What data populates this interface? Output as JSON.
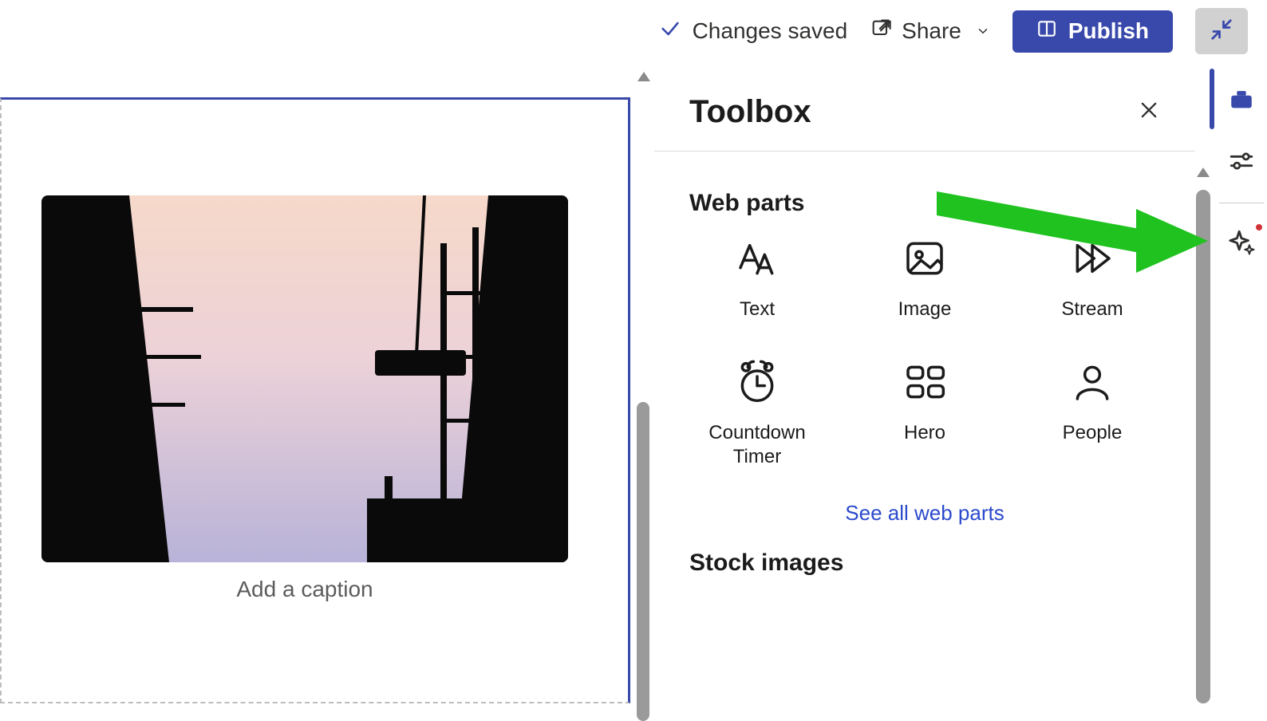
{
  "topbar": {
    "status_label": "Changes saved",
    "share_label": "Share",
    "publish_label": "Publish"
  },
  "canvas": {
    "caption_placeholder": "Add a caption"
  },
  "panel": {
    "title": "Toolbox",
    "sections": {
      "webparts_title": "Web parts",
      "stock_title": "Stock images",
      "see_all_label": "See all web parts"
    },
    "webparts": [
      {
        "name": "Text",
        "icon": "text-icon"
      },
      {
        "name": "Image",
        "icon": "image-icon"
      },
      {
        "name": "Stream",
        "icon": "stream-icon"
      },
      {
        "name": "Countdown Timer",
        "icon": "countdown-icon"
      },
      {
        "name": "Hero",
        "icon": "hero-icon"
      },
      {
        "name": "People",
        "icon": "people-icon"
      }
    ]
  },
  "rail": {
    "items": [
      {
        "name": "toolbox",
        "active": true
      },
      {
        "name": "settings",
        "active": false
      },
      {
        "name": "copilot",
        "active": false,
        "notification": true
      }
    ]
  },
  "colors": {
    "accent": "#3949ab",
    "link": "#2b4acb",
    "arrow": "#1fc21f"
  }
}
